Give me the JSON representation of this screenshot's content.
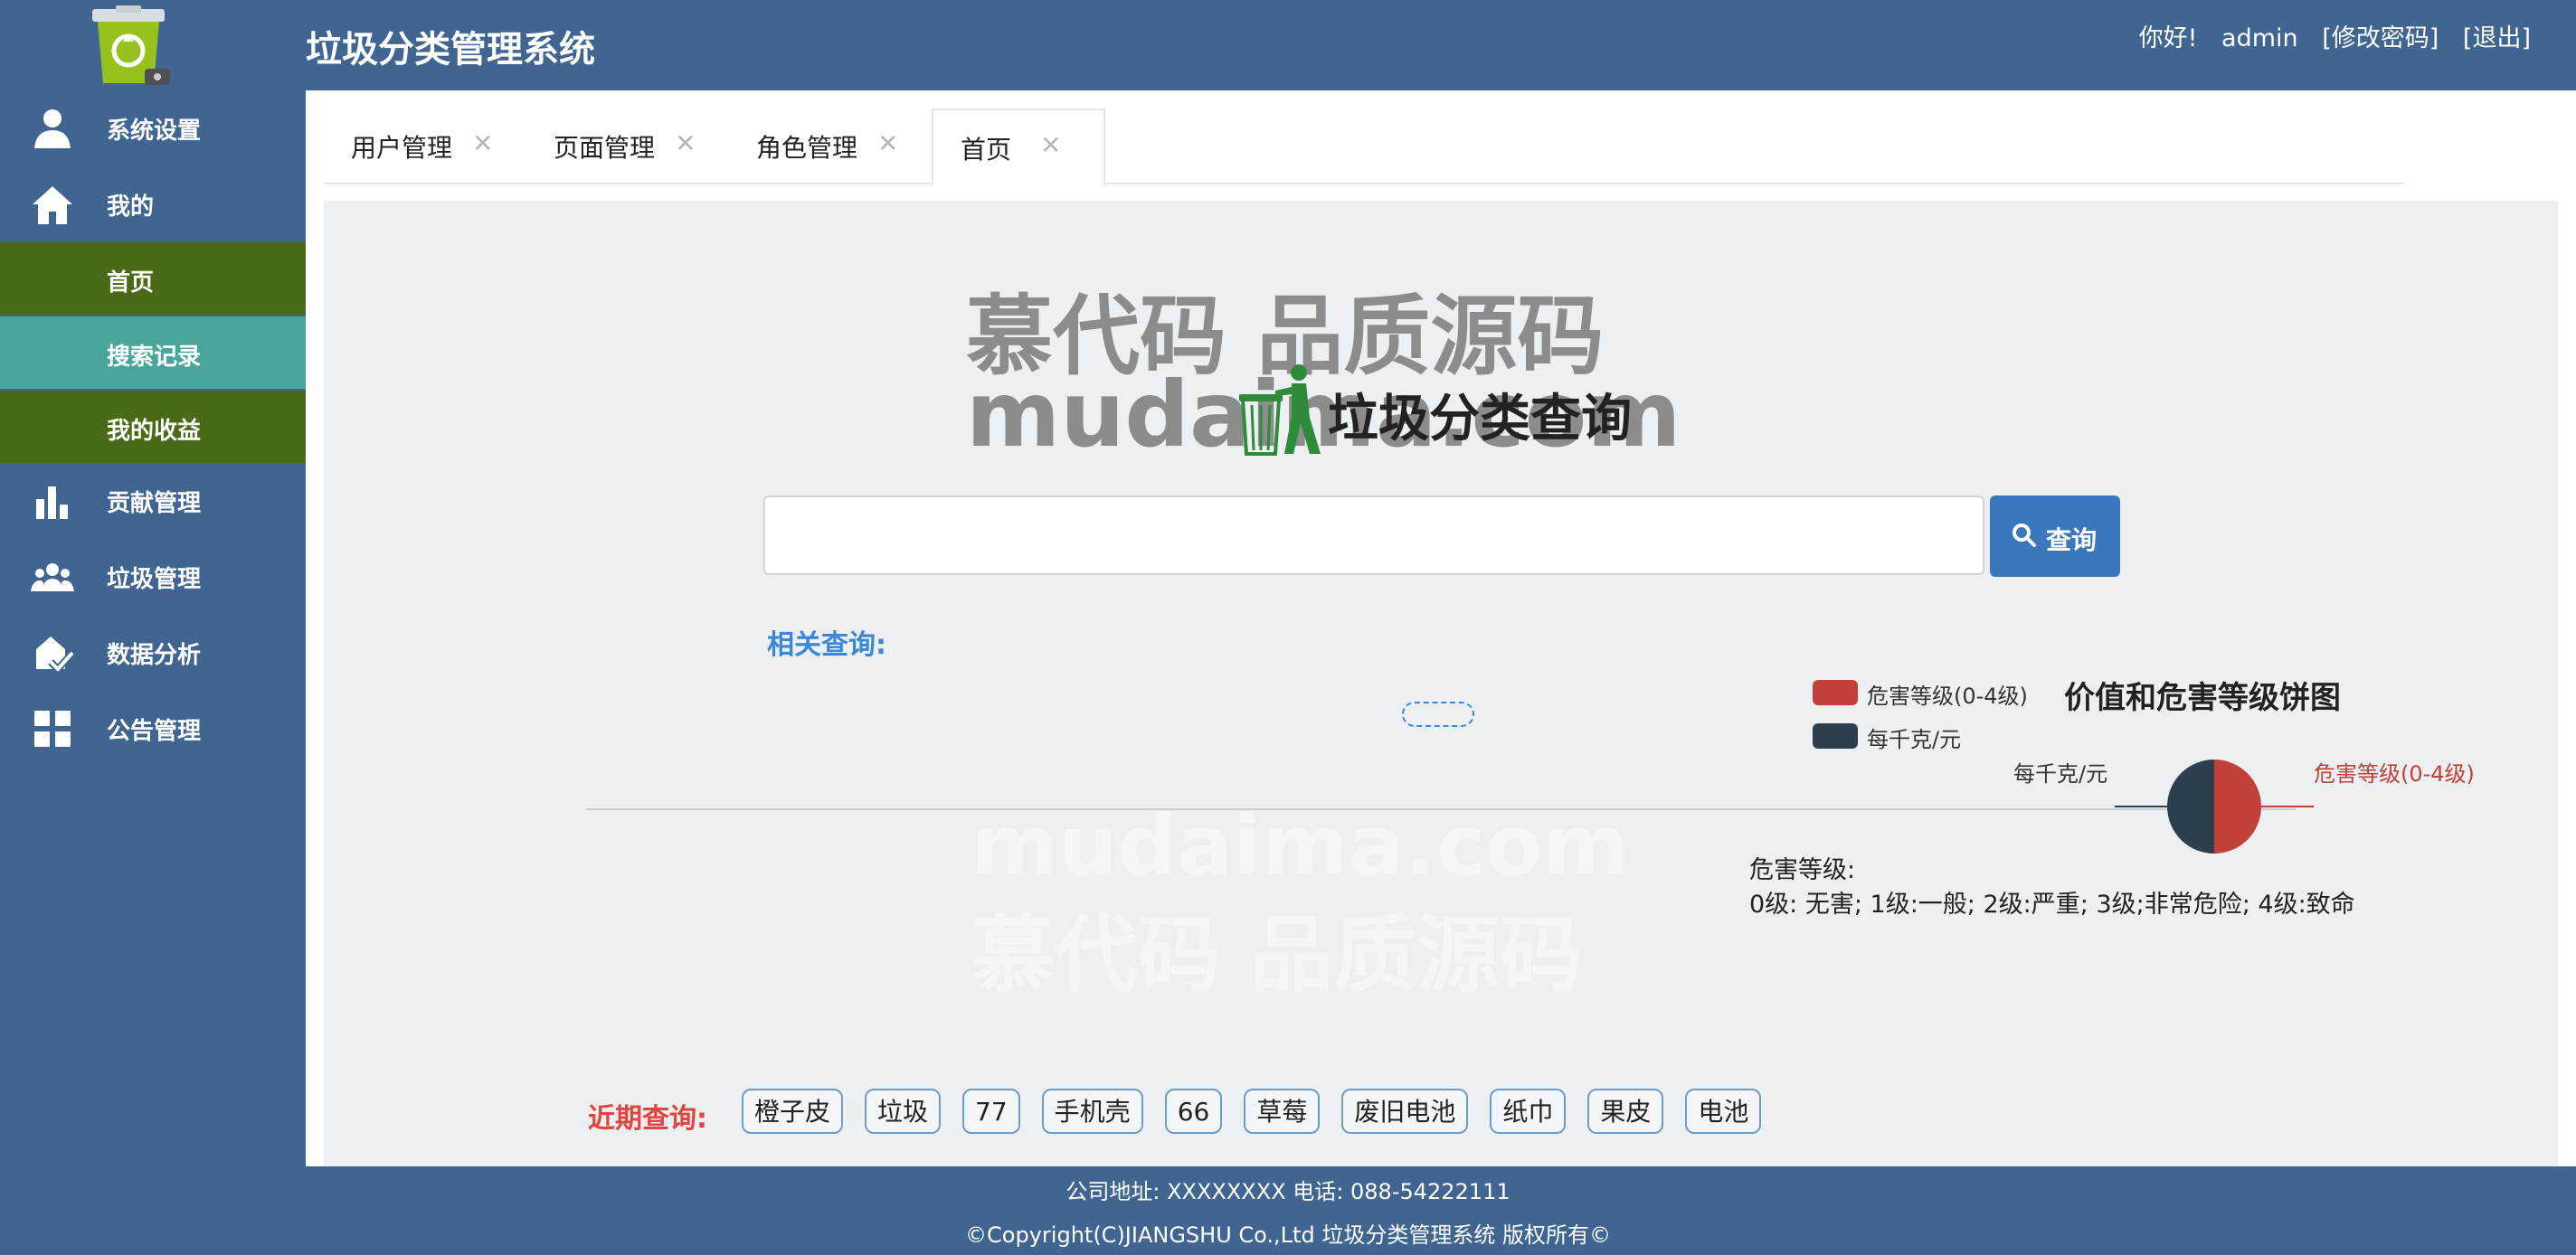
{
  "header": {
    "app_title": "垃圾分类管理系统",
    "greeting": "你好!",
    "username": "admin",
    "change_password": "[修改密码]",
    "logout": "[退出]"
  },
  "sidebar": {
    "items": [
      {
        "label": "系统设置",
        "icon": "user-settings-icon"
      },
      {
        "label": "我的",
        "icon": "home-icon"
      },
      {
        "label": "贡献管理",
        "icon": "bar-chart-icon"
      },
      {
        "label": "垃圾管理",
        "icon": "group-icon"
      },
      {
        "label": "数据分析",
        "icon": "analysis-icon"
      },
      {
        "label": "公告管理",
        "icon": "grid-icon"
      }
    ],
    "sub_items": [
      {
        "label": "首页",
        "bg": "#4b6a18"
      },
      {
        "label": "搜索记录",
        "bg": "#4aa69a"
      },
      {
        "label": "我的收益",
        "bg": "#4b6a18"
      }
    ]
  },
  "tabs": [
    {
      "label": "用户管理",
      "close": "✕"
    },
    {
      "label": "页面管理",
      "close": "✕"
    },
    {
      "label": "角色管理",
      "close": "✕"
    },
    {
      "label": "首页",
      "close": "✕",
      "active": true
    }
  ],
  "watermark": {
    "line1": "慕代码 品质源码",
    "line2": "mudaima.com"
  },
  "search": {
    "title": "垃圾分类查询",
    "input_value": "",
    "button_label": "查询",
    "related_label": "相关查询:"
  },
  "chart_data": {
    "type": "pie",
    "title": "价值和危害等级饼图",
    "legend_position": "left",
    "categories": [
      "危害等级(0-4级)",
      "每千克/元"
    ],
    "values": [
      1,
      1
    ],
    "colors": [
      "#c0403a",
      "#2f3e4d"
    ]
  },
  "hazard": {
    "title": "危害等级:",
    "description": "0级: 无害; 1级:一般; 2级:严重; 3级;非常危险; 4级:致命"
  },
  "recent": {
    "label": "近期查询:",
    "items": [
      "橙子皮",
      "垃圾",
      "77",
      "手机壳",
      "66",
      "草莓",
      "废旧电池",
      "纸巾",
      "果皮",
      "电池"
    ]
  },
  "footer": {
    "address": "公司地址: XXXXXXXX 电话: 088-54222111",
    "copyright": "©Copyright(C)JIANGSHU Co.,Ltd 垃圾分类管理系统 版权所有©"
  },
  "colors": {
    "primary": "#3f6590",
    "button": "#3a78bc",
    "accent_link": "#3d88d6",
    "recent_label": "#e0463d"
  }
}
